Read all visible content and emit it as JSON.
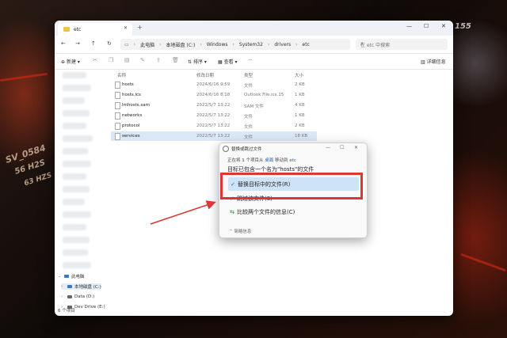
{
  "window": {
    "tab_title": "etc",
    "tab_close": "✕",
    "new_tab": "+",
    "minimize": "—",
    "maximize": "☐",
    "close": "✕"
  },
  "nav": {
    "back": "←",
    "forward": "→",
    "up": "↑",
    "refresh": "↻",
    "monitor_icon": "▭",
    "breadcrumb": [
      "此电脑",
      "本地磁盘 (C:)",
      "Windows",
      "System32",
      "drivers",
      "etc"
    ],
    "search_placeholder": "在 etc 中搜索"
  },
  "toolbar": {
    "new_label": "新建",
    "sort_label": "排序",
    "view_label": "查看",
    "more": "···",
    "details_label": "详细信息"
  },
  "sidebar": {
    "items": [
      {
        "label": "此电脑"
      },
      {
        "label": "本地磁盘 (C:)"
      },
      {
        "label": "Data (D:)"
      },
      {
        "label": "Dev Drive (E:)"
      }
    ]
  },
  "filelist": {
    "headers": {
      "name": "名称",
      "date": "修改日期",
      "type": "类型",
      "size": "大小"
    },
    "rows": [
      {
        "name": "hosts",
        "date": "2024/6/16 9:59",
        "type": "文件",
        "size": "2 KB"
      },
      {
        "name": "hosts.ics",
        "date": "2024/6/16 8:18",
        "type": "Outlook File.ics.15",
        "size": "1 KB"
      },
      {
        "name": "lmhosts.sam",
        "date": "2022/5/7 13:22",
        "type": "SAM 文件",
        "size": "4 KB"
      },
      {
        "name": "networks",
        "date": "2022/5/7 13:22",
        "type": "文件",
        "size": "1 KB"
      },
      {
        "name": "protocol",
        "date": "2022/5/7 13:22",
        "type": "文件",
        "size": "2 KB"
      },
      {
        "name": "services",
        "date": "2022/5/7 13:22",
        "type": "文件",
        "size": "18 KB"
      }
    ]
  },
  "status": {
    "item_count": "6 个项目"
  },
  "dialog": {
    "title": "替换或跳过文件",
    "line1_a": "正在将 1 个项目从",
    "line1_src": "桌面",
    "line1_b": "移动到",
    "line1_dst": "etc",
    "line2": "目标已包含一个名为\"hosts\"的文件",
    "options": [
      {
        "icon": "✓",
        "label": "替换目标中的文件(R)"
      },
      {
        "icon": "↗",
        "label": "跳过该文件(S)"
      },
      {
        "icon": "⇆",
        "label": "比较两个文件的信息(C)"
      }
    ],
    "fewer": "简略信息"
  },
  "decor": {
    "text1": "SV_0584",
    "text2": "56 H2S",
    "text3": "63 HZS",
    "text4": "155"
  },
  "colors": {
    "highlight_box": "#e03535",
    "selected_row": "#dbe8f7",
    "accent": "#1a5fb4"
  }
}
